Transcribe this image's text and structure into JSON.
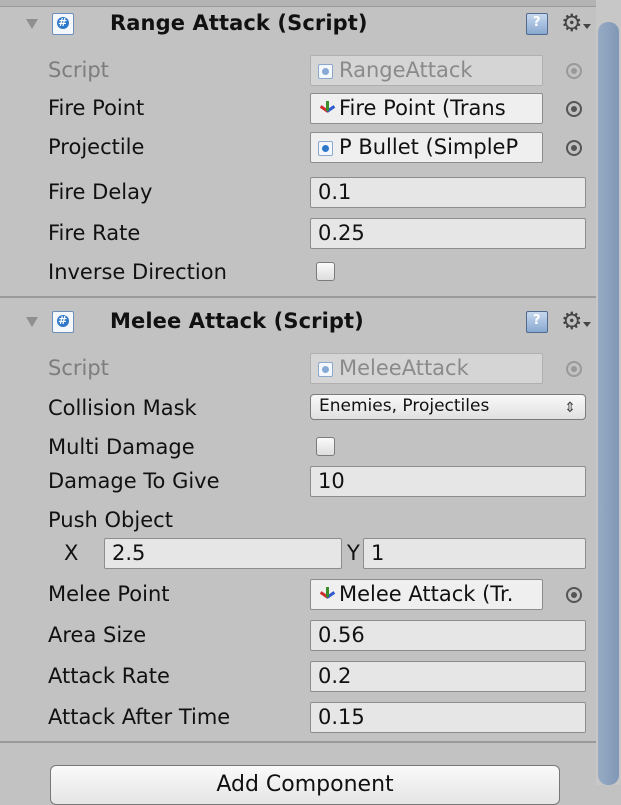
{
  "components": {
    "range_attack": {
      "title": "Range Attack (Script)",
      "script_label": "Script",
      "script_value": "RangeAttack",
      "fire_point_label": "Fire Point",
      "fire_point_value": "Fire Point (Trans",
      "projectile_label": "Projectile",
      "projectile_value": "P Bullet (SimpleP",
      "fire_delay_label": "Fire Delay",
      "fire_delay_value": "0.1",
      "fire_rate_label": "Fire Rate",
      "fire_rate_value": "0.25",
      "inverse_direction_label": "Inverse Direction",
      "inverse_direction_checked": false
    },
    "melee_attack": {
      "title": "Melee Attack (Script)",
      "script_label": "Script",
      "script_value": "MeleeAttack",
      "collision_mask_label": "Collision Mask",
      "collision_mask_value": "Enemies, Projectiles",
      "multi_damage_label": "Multi Damage",
      "multi_damage_checked": false,
      "damage_to_give_label": "Damage To Give",
      "damage_to_give_value": "10",
      "push_object_label": "Push Object",
      "push_x_label": "X",
      "push_x_value": "2.5",
      "push_y_label": "Y",
      "push_y_value": "1",
      "melee_point_label": "Melee Point",
      "melee_point_value": "Melee Attack (Tr.",
      "area_size_label": "Area Size",
      "area_size_value": "0.56",
      "attack_rate_label": "Attack Rate",
      "attack_rate_value": "0.2",
      "attack_after_time_label": "Attack After Time",
      "attack_after_time_value": "0.15"
    }
  },
  "footer": {
    "add_component_label": "Add Component"
  },
  "icons": {
    "foldout": "triangle-down-icon",
    "script": "script-icon",
    "help": "help-book-icon",
    "settings": "gear-icon",
    "object_picker": "target-icon",
    "transform": "transform-icon",
    "dropdown": "up-down-arrows-icon"
  },
  "colors": {
    "panel_bg": "#c2c2c2",
    "field_bg": "#e6e6e6",
    "scrollbar_thumb": "#8aa0bf",
    "disabled_text": "#7d7d7d"
  }
}
